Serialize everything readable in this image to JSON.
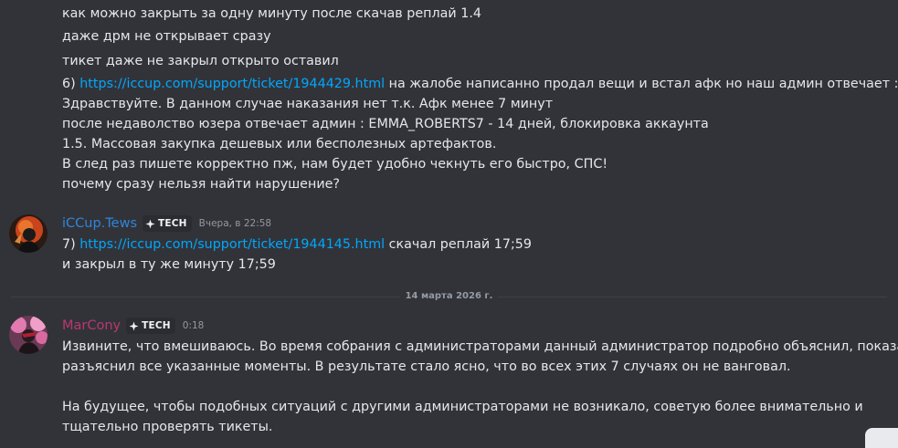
{
  "prev_lines": [
    "как можно закрыть за одну минуту после скачав реплай 1.4",
    "даже дрм не открывает сразу",
    "тикет даже не закрыл открыто оставил"
  ],
  "item6": {
    "prefix": "6) ",
    "link": "https://iccup.com/support/ticket/1944429.html",
    "suffix": " на жалобе написанно продал вещи и встал афк но наш админ отвечает :"
  },
  "item6_lines": [
    "Здравствуйте. В данном случае наказания нет т.к. Афк менее 7 минут",
    "после недаволство юзера отвечает админ : EMMA_ROBERTS7 - 14 дней, блокировка аккаунта",
    "1.5. Массовая закупка дешевых или бесполезных артефактов.",
    "В след раз пишете корректно пж, нам будет удобно чекнуть его быстро, СПС!",
    "почему сразу нельзя найти нарушение?"
  ],
  "msg_tews": {
    "username": "iCCup.Tews",
    "username_color": "#2f86d9",
    "tag": "TECH",
    "timestamp": "Вчера, в 22:58",
    "item7_prefix": "7) ",
    "item7_link": "https://iccup.com/support/ticket/1944145.html",
    "item7_suffix": " скачал реплай 17;59",
    "line2": "и закрыл в ту же минуту 17;59"
  },
  "date_divider": "14 марта 2026 г.",
  "msg_marcony": {
    "username": "MarCony",
    "username_color": "#b8386f",
    "tag": "TECH",
    "timestamp": "0:18",
    "lines": [
      "Извините, что вмешиваюсь. Во время собрания с администраторами данный администратор подробно объяснил, показал и",
      "разъяснил все указанные моменты. В результате стало ясно, что во всех этих 7 случаях он не  ванговал.",
      "На будущее, чтобы подобных ситуаций с другими администраторами не возникало, советую более внимательно и",
      "тщательно проверять тикеты."
    ]
  },
  "colors": {
    "background": "#323339",
    "link": "#00a8fc",
    "text": "#e6e7ea",
    "muted": "#949ba4"
  }
}
